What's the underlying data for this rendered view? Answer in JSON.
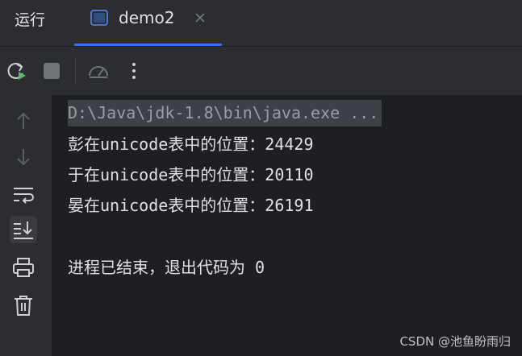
{
  "tool_window": {
    "title": "运行",
    "tab": {
      "label": "demo2",
      "close_glyph": "✕",
      "icon": "console-icon"
    }
  },
  "toolbar": {
    "buttons": [
      "rerun-icon",
      "stop-icon",
      "profiler-icon",
      "more-icon"
    ]
  },
  "sidebar": {
    "buttons": [
      "arrow-up-icon",
      "arrow-down-icon",
      "soft-wrap-icon",
      "scroll-to-end-icon",
      "print-icon",
      "trash-icon"
    ]
  },
  "console": {
    "command": "D:\\Java\\jdk-1.8\\bin\\java.exe ...",
    "output": [
      "彭在unicode表中的位置：24429",
      "于在unicode表中的位置：20110",
      "晏在unicode表中的位置：26191"
    ],
    "exit_message": "进程已结束，退出代码为 0"
  },
  "watermark": "CSDN @池鱼盼雨归",
  "colors": {
    "background": "#1e1f22",
    "panel": "#2b2d30",
    "accent": "#3574f0",
    "text": "#dfe1e5",
    "muted": "#9b9da2"
  }
}
